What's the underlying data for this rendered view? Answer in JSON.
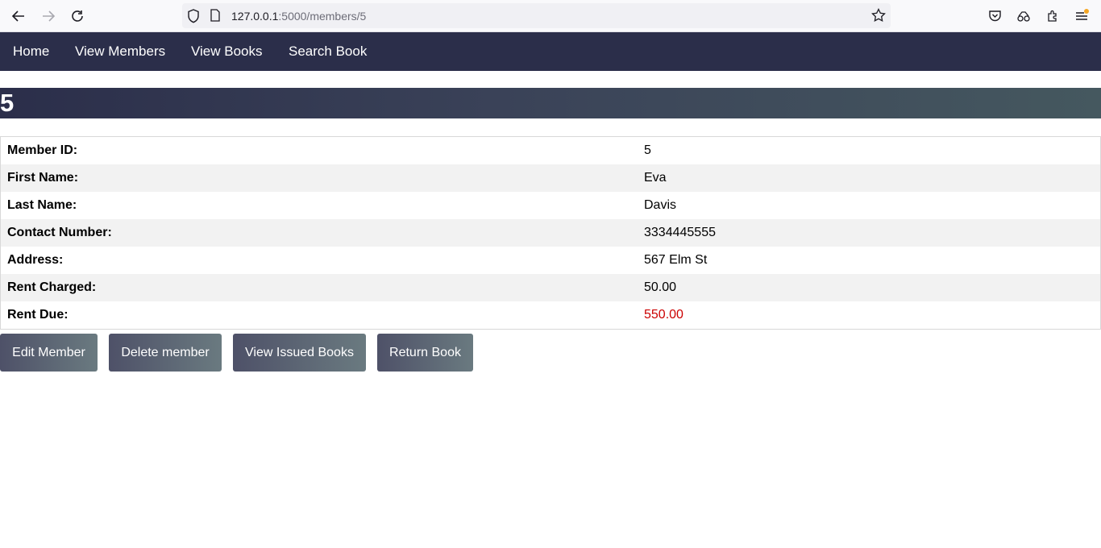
{
  "browser": {
    "url_host": "127.0.0.1",
    "url_path": ":5000/members/5",
    "icons": {
      "back": "back-arrow-icon",
      "forward": "forward-arrow-icon",
      "reload": "reload-icon",
      "shield": "tracking-shield-icon",
      "page": "page-icon",
      "bookmark": "bookmark-star-icon",
      "pocket": "pocket-icon",
      "accounts": "account-icon",
      "extensions": "extensions-icon",
      "menu": "menu-icon"
    }
  },
  "nav": {
    "items": [
      {
        "label": "Home"
      },
      {
        "label": "View Members"
      },
      {
        "label": "View Books"
      },
      {
        "label": "Search Book"
      }
    ]
  },
  "page": {
    "title": "5"
  },
  "member": {
    "rows": [
      {
        "label": "Member ID:",
        "value": "5"
      },
      {
        "label": "First Name:",
        "value": "Eva"
      },
      {
        "label": "Last Name:",
        "value": "Davis"
      },
      {
        "label": "Contact Number:",
        "value": "3334445555"
      },
      {
        "label": "Address:",
        "value": "567 Elm St"
      },
      {
        "label": "Rent Charged:",
        "value": "50.00"
      },
      {
        "label": "Rent Due:",
        "value": "550.00"
      }
    ]
  },
  "actions": {
    "edit": "Edit Member",
    "delete": "Delete member",
    "issued": "View Issued Books",
    "return": "Return Book"
  },
  "colors": {
    "navbar": "#2b2e4a",
    "rent_due": "#cc0000",
    "row_alt": "#f2f2f2"
  }
}
